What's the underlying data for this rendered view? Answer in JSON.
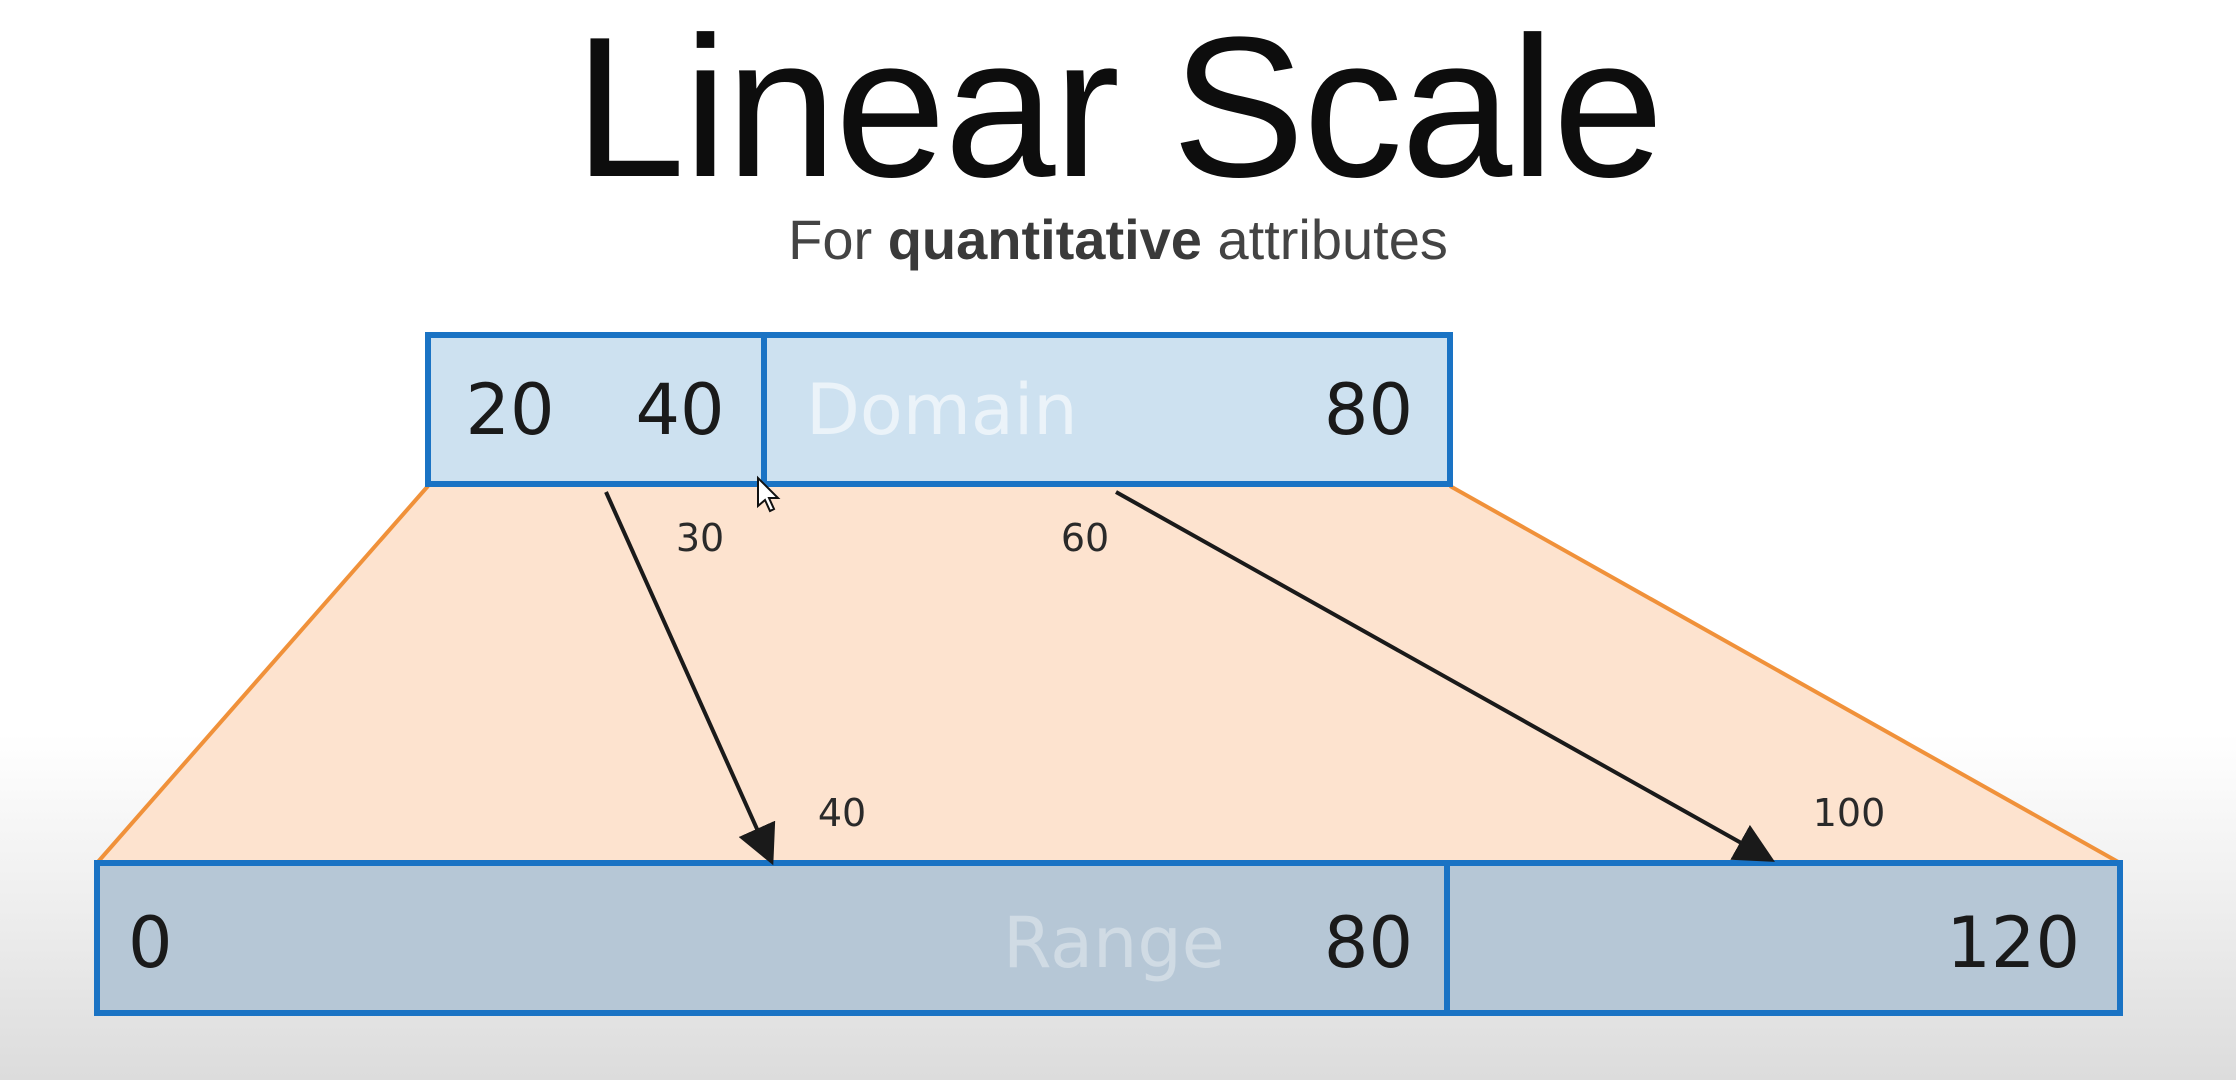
{
  "title": "Linear Scale",
  "subtitle": {
    "prefix": "For",
    "emphasis": "quantitative",
    "suffix": "attributes"
  },
  "domain": {
    "label": "Domain",
    "start": "20",
    "split": "40",
    "end": "80"
  },
  "range": {
    "label": "Range",
    "start": "0",
    "split": "80",
    "end": "120"
  },
  "mappings": [
    {
      "from": "30",
      "to": "40"
    },
    {
      "from": "60",
      "to": "100"
    }
  ],
  "colors": {
    "box_border": "#1a73c4",
    "domain_fill": "#cde1f0",
    "range_fill": "#b6c7d6",
    "trapezoid_fill": "#fde3cf",
    "trapezoid_edge": "#f0913a",
    "arrow": "#1a1a1a"
  }
}
